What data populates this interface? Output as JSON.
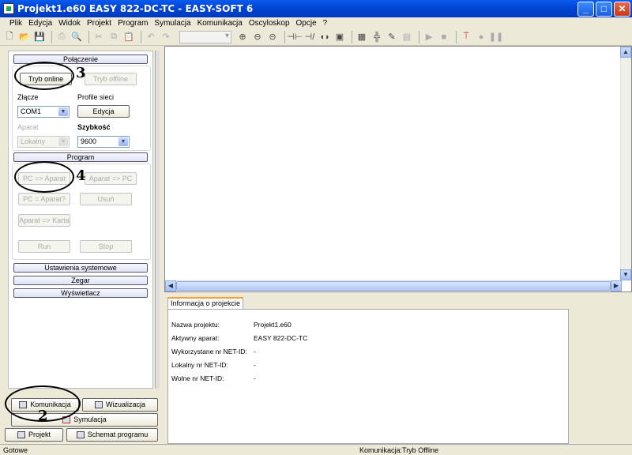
{
  "window": {
    "title": "Projekt1.e60 EASY 822-DC-TC - EASY-SOFT 6"
  },
  "menu": [
    "Plik",
    "Edycja",
    "Widok",
    "Projekt",
    "Program",
    "Symulacja",
    "Komunikacja",
    "Oscyloskop",
    "Opcje",
    "?"
  ],
  "connection": {
    "header": "Połączenie",
    "online_button": "Tryb online",
    "offline_button": "Tryb offline",
    "port_label": "Złącze",
    "port_value": "COM1",
    "profiles_label": "Profile sieci",
    "edit_button": "Edycja",
    "device_label": "Aparat",
    "device_value": "Lokalny",
    "speed_label": "Szybkość",
    "speed_value": "9600"
  },
  "program": {
    "header": "Program",
    "pc_to_device": "PC => Aparat",
    "device_to_pc": "Aparat => PC",
    "pc_eq_device": "PC = Aparat?",
    "delete": "Usuń",
    "device_to_card": "Aparat => Karta",
    "run": "Run",
    "stop": "Stop"
  },
  "sections": {
    "system_settings": "Ustawienia systemowe",
    "clock": "Zegar",
    "display": "Wyświetlacz"
  },
  "tabs": {
    "communication": "Komunikacja",
    "visualization": "Wizualizacja",
    "simulation": "Symulacja",
    "project": "Projekt",
    "program_diagram": "Schemat programu"
  },
  "callouts": {
    "c2": "2",
    "c3": "3",
    "c4": "4"
  },
  "project_info": {
    "tab": "Informacja o projekcie",
    "rows": [
      {
        "key": "Nazwa projektu:",
        "value": "Projekt1.e60"
      },
      {
        "key": "Aktywny aparat:",
        "value": "EASY 822-DC-TC"
      },
      {
        "key": "Wykorzystane nr NET-ID:",
        "value": "-"
      },
      {
        "key": "Lokalny nr NET-ID:",
        "value": "-"
      },
      {
        "key": "Wolne nr NET-ID:",
        "value": "-"
      }
    ]
  },
  "status": {
    "left": "Gotowe",
    "right": "Komunikacja:Tryb Offline"
  }
}
